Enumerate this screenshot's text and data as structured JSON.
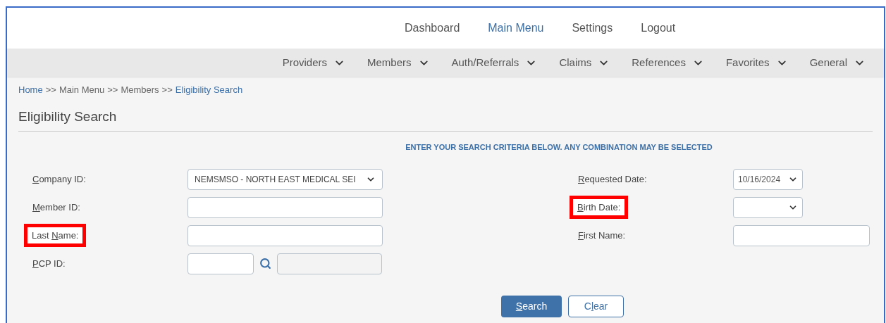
{
  "top_nav": [
    {
      "label": "Dashboard",
      "selected": false
    },
    {
      "label": "Main Menu",
      "selected": true
    },
    {
      "label": "Settings",
      "selected": false
    },
    {
      "label": "Logout",
      "selected": false
    }
  ],
  "menu_bar": [
    "Providers",
    "Members",
    "Auth/Referrals",
    "Claims",
    "References",
    "Favorites",
    "General"
  ],
  "breadcrumb": [
    {
      "label": "Home",
      "link": true
    },
    {
      "label": "Main Menu",
      "link": false
    },
    {
      "label": "Members",
      "link": false
    },
    {
      "label": "Eligibility Search",
      "link": true
    }
  ],
  "breadcrumb_separator": ">>",
  "page_title": "Eligibility Search",
  "instructions": "ENTER YOUR SEARCH CRITERIA BELOW. ANY COMBINATION MAY BE SELECTED",
  "left_fields": [
    {
      "kind": "select",
      "label": {
        "key": "C",
        "after": "ompany ID:"
      },
      "value": "NEMSMSO - NORTH EAST MEDICAL SEI",
      "highlighted": false
    },
    {
      "kind": "text",
      "label": {
        "key": "M",
        "after": "ember ID:"
      },
      "highlighted": false
    },
    {
      "kind": "text",
      "label": {
        "before": "Last  ",
        "key": "N",
        "after": "ame:"
      },
      "highlighted": true
    },
    {
      "kind": "lookup",
      "label": {
        "key": "P",
        "after": "CP ID:"
      },
      "highlighted": false
    }
  ],
  "right_fields": [
    {
      "kind": "date",
      "label": {
        "key": "R",
        "after": "equested Date:"
      },
      "value": "10/16/2024",
      "highlighted": false
    },
    {
      "kind": "date",
      "label": {
        "key": "B",
        "after": "irth Date:"
      },
      "highlighted": true
    },
    {
      "kind": "text",
      "label": {
        "key": "F",
        "after": "irst Name:"
      },
      "highlighted": false
    }
  ],
  "buttons": [
    {
      "kind": "primary",
      "label": {
        "key": "S",
        "after": "earch"
      }
    },
    {
      "kind": "secondary",
      "label": {
        "before": "C",
        "key": "l",
        "after": "ear"
      }
    }
  ]
}
